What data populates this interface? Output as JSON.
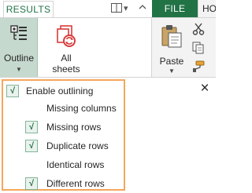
{
  "tabs": {
    "results": "RESULTS",
    "file": "FILE",
    "home": "HO"
  },
  "ribbon": {
    "outline_label": "Outline",
    "all_sheets_line1": "All",
    "all_sheets_line2": "sheets",
    "paste_label": "Paste"
  },
  "popup": {
    "enable_outlining": "Enable outlining",
    "options": [
      {
        "label": "Missing columns",
        "checked": false
      },
      {
        "label": "Missing rows",
        "checked": true
      },
      {
        "label": "Duplicate rows",
        "checked": true
      },
      {
        "label": "Identical rows",
        "checked": false
      },
      {
        "label": "Different rows",
        "checked": true
      }
    ],
    "check_glyph": "√",
    "close_glyph": "×"
  },
  "colors": {
    "excel_green": "#217346",
    "outline_highlight": "#c6d9ce",
    "popup_border": "#f4a65b",
    "icon_red": "#d83b3b"
  },
  "icons": [
    "outline-icon",
    "all-sheets-icon",
    "paste-icon",
    "cut-icon",
    "copy-icon",
    "format-painter-icon",
    "close-icon",
    "view-icon",
    "chevron-down-icon",
    "chevron-up-icon"
  ]
}
